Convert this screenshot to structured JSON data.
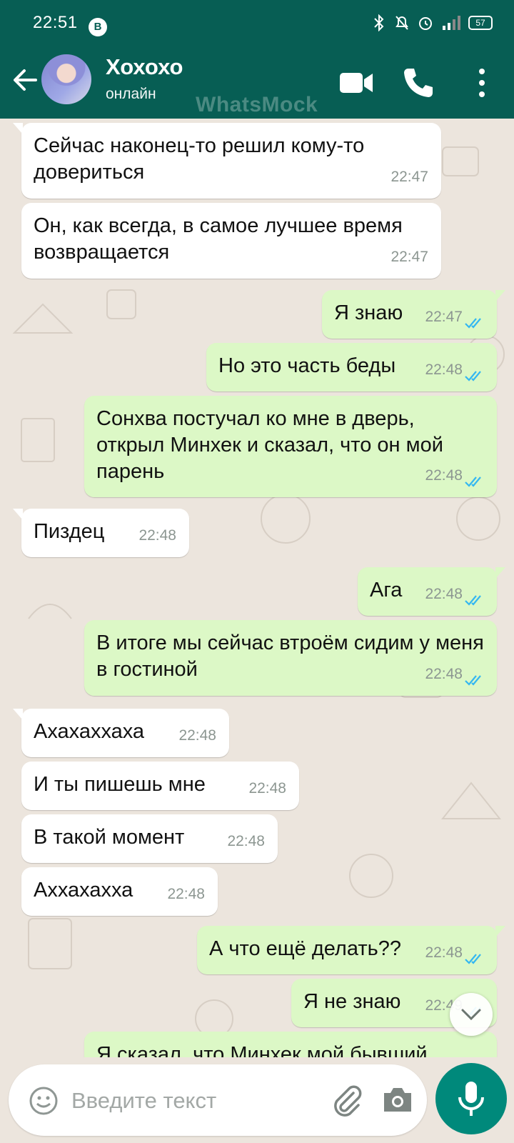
{
  "status_bar": {
    "time": "22:51",
    "badge": "B",
    "battery": "57"
  },
  "header": {
    "contact_name": "Хохохо",
    "contact_status": "онлайн",
    "watermark": "WhatsMock"
  },
  "messages": [
    {
      "dir": "in",
      "text": "Сейчас наконец-то решил кому-то довериться",
      "time": "22:47"
    },
    {
      "dir": "in",
      "text": "Он, как всегда, в самое лучшее время возвращается",
      "time": "22:47"
    },
    {
      "dir": "out",
      "text": "Я знаю",
      "time": "22:47"
    },
    {
      "dir": "out",
      "text": "Но это часть беды",
      "time": "22:48"
    },
    {
      "dir": "out",
      "text": "Сонхва постучал ко мне в дверь, открыл Минхек и сказал, что он мой парень",
      "time": "22:48"
    },
    {
      "dir": "in",
      "text": "Пиздец",
      "time": "22:48"
    },
    {
      "dir": "out",
      "text": "Ага",
      "time": "22:48"
    },
    {
      "dir": "out",
      "text": "В итоге мы сейчас втроём сидим у меня в гостиной",
      "time": "22:48"
    },
    {
      "dir": "in",
      "text": "Ахахаххаха",
      "time": "22:48"
    },
    {
      "dir": "in",
      "text": "И ты пишешь мне",
      "time": "22:48"
    },
    {
      "dir": "in",
      "text": "В такой момент",
      "time": "22:48"
    },
    {
      "dir": "in",
      "text": "Аххахахха",
      "time": "22:48"
    },
    {
      "dir": "out",
      "text": "А что ещё делать??",
      "time": "22:48"
    },
    {
      "dir": "out",
      "text": "Я не знаю",
      "time": "22:49"
    },
    {
      "dir": "out",
      "text": "Я сказал, что Минхек мой бывший",
      "time": ""
    }
  ],
  "composer": {
    "placeholder": "Введите текст"
  },
  "colors": {
    "header": "#075e54",
    "outgoing_bubble": "#dcf8c6",
    "incoming_bubble": "#ffffff",
    "tick_read": "#34b7f1",
    "fab": "#00897b"
  }
}
